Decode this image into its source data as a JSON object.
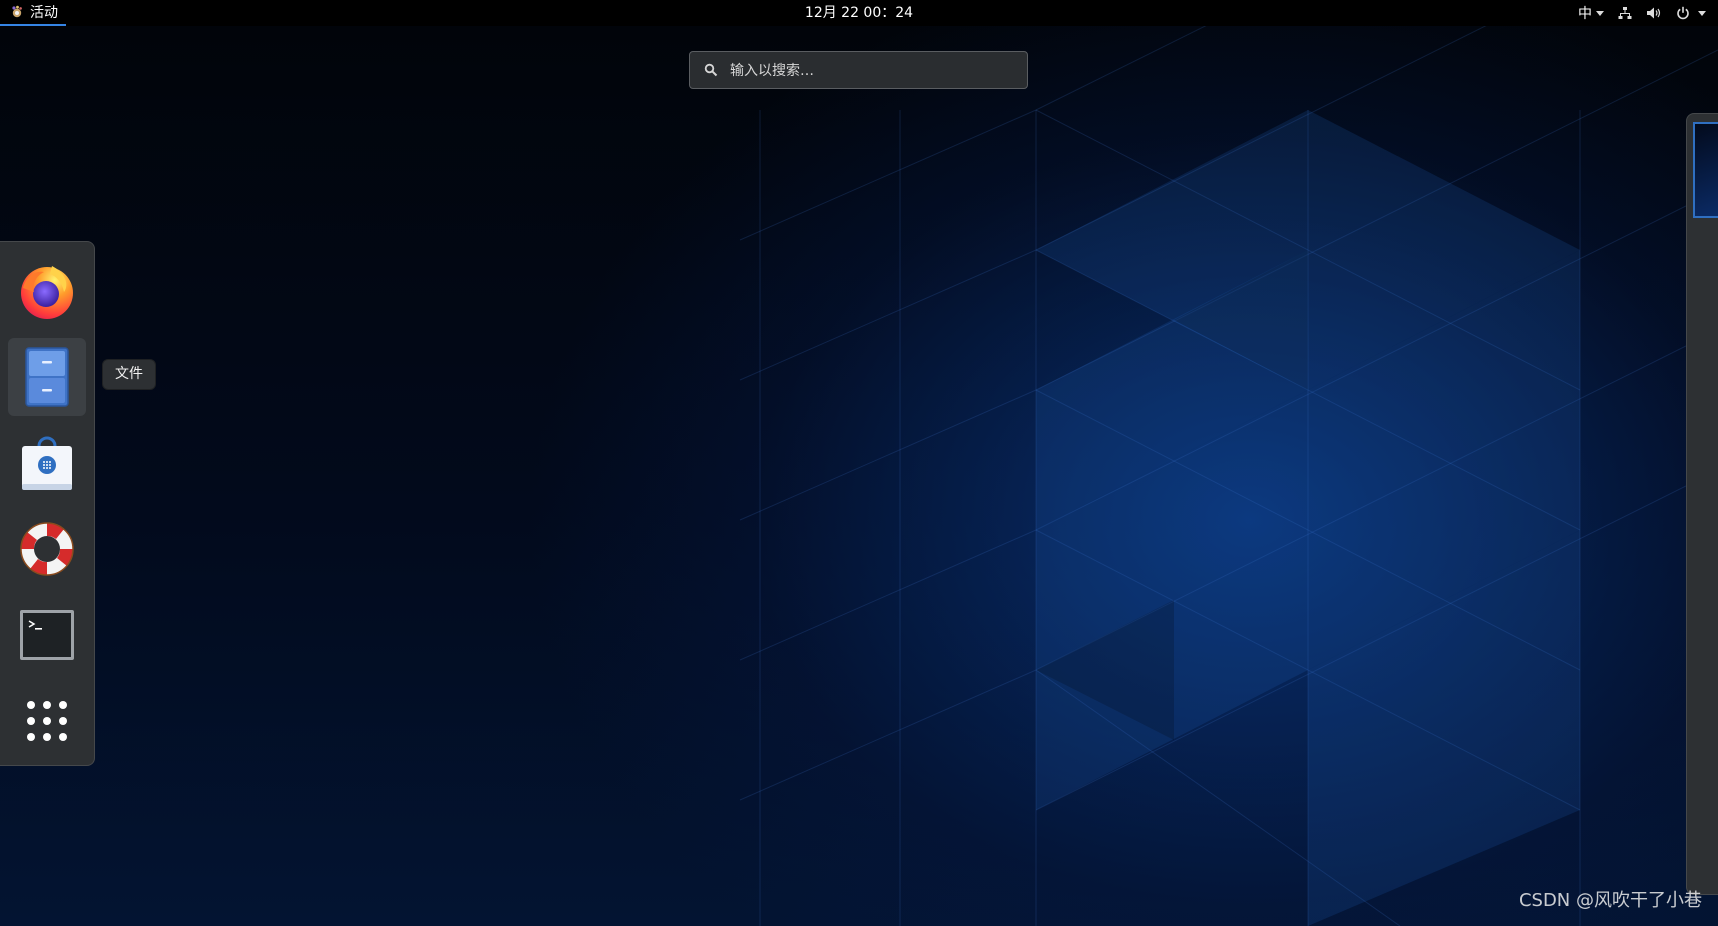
{
  "topbar": {
    "activities_label": "活动",
    "clock": "12月 22  00：24",
    "input_method": "中"
  },
  "search": {
    "placeholder": "输入以搜索…"
  },
  "dash": {
    "items": [
      {
        "name": "firefox",
        "icon": "firefox-icon"
      },
      {
        "name": "files",
        "icon": "file-cabinet-icon",
        "selected": true
      },
      {
        "name": "software",
        "icon": "shopping-bag-icon"
      },
      {
        "name": "help",
        "icon": "lifebuoy-icon"
      },
      {
        "name": "terminal",
        "icon": "terminal-icon"
      },
      {
        "name": "show-applications",
        "icon": "grid-dots-icon"
      }
    ],
    "tooltip": "文件"
  },
  "watermark": "CSDN @风吹干了小巷",
  "colors": {
    "accent": "#3584e4",
    "panel": "#2d3033",
    "topbar": "#000000"
  }
}
